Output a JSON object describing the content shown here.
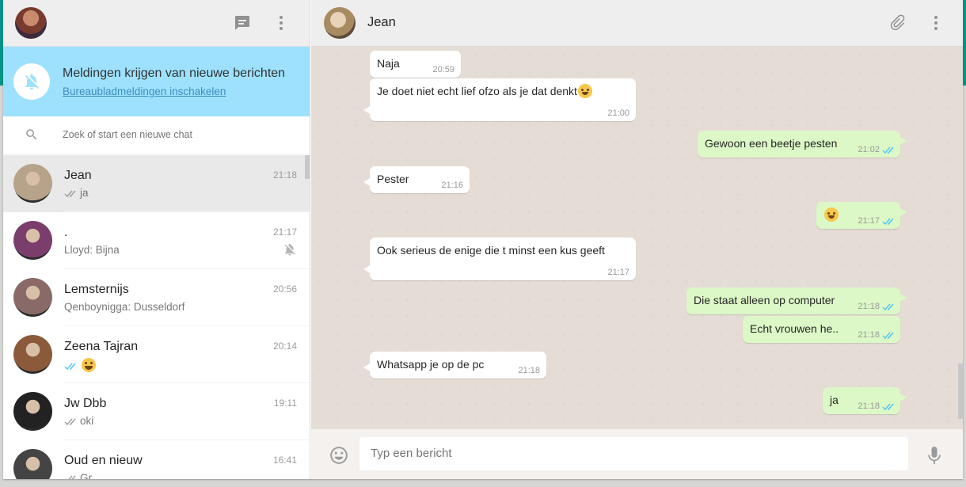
{
  "sidebar": {
    "notification": {
      "title": "Meldingen krijgen van nieuwe berichten",
      "link": "Bureaubladmeldingen inschakelen"
    },
    "search": {
      "placeholder": "Zoek of start een nieuwe chat"
    },
    "chats": [
      {
        "name": "Jean",
        "time": "21:18",
        "preview": "ja",
        "ticks": "grey",
        "emoji": "",
        "muted": false,
        "active": true,
        "avatar": "#b7a38a"
      },
      {
        "name": ".",
        "time": "21:17",
        "preview": "Lloyd: Bijna",
        "ticks": "",
        "emoji": "",
        "muted": true,
        "active": false,
        "avatar": "#7b3d6b"
      },
      {
        "name": "Lemsternijs",
        "time": "20:56",
        "preview": "Qenboynigga: Dusseldorf",
        "ticks": "",
        "emoji": "",
        "muted": false,
        "active": false,
        "avatar": "#8a6a68"
      },
      {
        "name": "Zeena Tajran",
        "time": "20:14",
        "preview": "",
        "ticks": "blue",
        "emoji": "laugh",
        "muted": false,
        "active": false,
        "avatar": "#8a5a3a"
      },
      {
        "name": "Jw Dbb",
        "time": "19:11",
        "preview": "oki",
        "ticks": "grey",
        "emoji": "",
        "muted": false,
        "active": false,
        "avatar": "#222222"
      },
      {
        "name": "Oud en nieuw",
        "time": "16:41",
        "preview": "Gr",
        "ticks": "grey",
        "emoji": "",
        "muted": false,
        "active": false,
        "avatar": "#444444"
      }
    ]
  },
  "conversation": {
    "name": "Jean",
    "composer_placeholder": "Typ een bericht",
    "messages": [
      {
        "dir": "in",
        "text": "Naja",
        "time": "20:59",
        "tail": false
      },
      {
        "dir": "in",
        "text": "Je doet niet echt lief ofzo als je dat denkt",
        "emoji": "grin",
        "time": "21:00",
        "tail": true
      },
      {
        "dir": "out",
        "text": "Gewoon een beetje pesten",
        "time": "21:02",
        "tail": true
      },
      {
        "dir": "in",
        "text": "Pester",
        "time": "21:16",
        "tail": true
      },
      {
        "dir": "out",
        "text": "",
        "emoji": "kiss",
        "time": "21:17",
        "tail": true
      },
      {
        "dir": "in",
        "text": "Ook serieus de enige die t minst een kus geeft",
        "time": "21:17",
        "tail": true
      },
      {
        "dir": "out",
        "text": "Die staat alleen op computer",
        "time": "21:18",
        "tail": true
      },
      {
        "dir": "out",
        "text": "Echt vrouwen he..",
        "time": "21:18",
        "tail": false
      },
      {
        "dir": "in",
        "text": "Whatsapp je op de pc",
        "time": "21:18",
        "tail": true
      },
      {
        "dir": "out",
        "text": "ja",
        "time": "21:18",
        "tail": true
      }
    ]
  },
  "colors": {
    "accent": "#009688",
    "notification_bg": "#9de1fe",
    "outgoing_bubble": "#dcf8c6",
    "tick_blue": "#4fc3f7"
  }
}
